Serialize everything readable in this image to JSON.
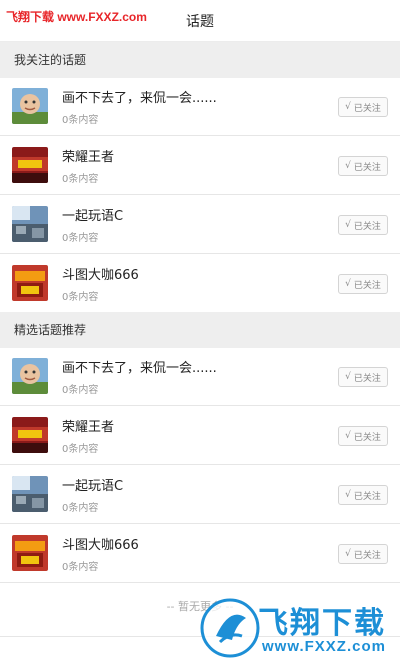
{
  "watermark": {
    "top_text": "飞翔下载 www.FXXZ.com",
    "brand_text": "飞翔下载",
    "brand_url": "www.FXXZ.com"
  },
  "header": {
    "title": "话题"
  },
  "sections": {
    "followed": "我关注的话题",
    "recommended": "精选话题推荐"
  },
  "followed_items": [
    {
      "title": "画不下去了，来侃一会......",
      "sub": "0条内容",
      "button": "已关注",
      "check": "√"
    },
    {
      "title": "荣耀王者",
      "sub": "0条内容",
      "button": "已关注",
      "check": "√"
    },
    {
      "title": "一起玩语C",
      "sub": "0条内容",
      "button": "已关注",
      "check": "√"
    },
    {
      "title": "斗图大咖666",
      "sub": "0条内容",
      "button": "已关注",
      "check": "√"
    }
  ],
  "recommended_items": [
    {
      "title": "画不下去了，来侃一会......",
      "sub": "0条内容",
      "button": "已关注",
      "check": "√"
    },
    {
      "title": "荣耀王者",
      "sub": "0条内容",
      "button": "已关注",
      "check": "√"
    },
    {
      "title": "一起玩语C",
      "sub": "0条内容",
      "button": "已关注",
      "check": "√"
    },
    {
      "title": "斗图大咖666",
      "sub": "0条内容",
      "button": "已关注",
      "check": "√"
    }
  ],
  "footer": {
    "text": "-- 暂无更多 --"
  },
  "colors": {
    "accent": "#1d8fd6",
    "watermark_red": "#e8262a",
    "section_bg": "#eeeeee"
  }
}
